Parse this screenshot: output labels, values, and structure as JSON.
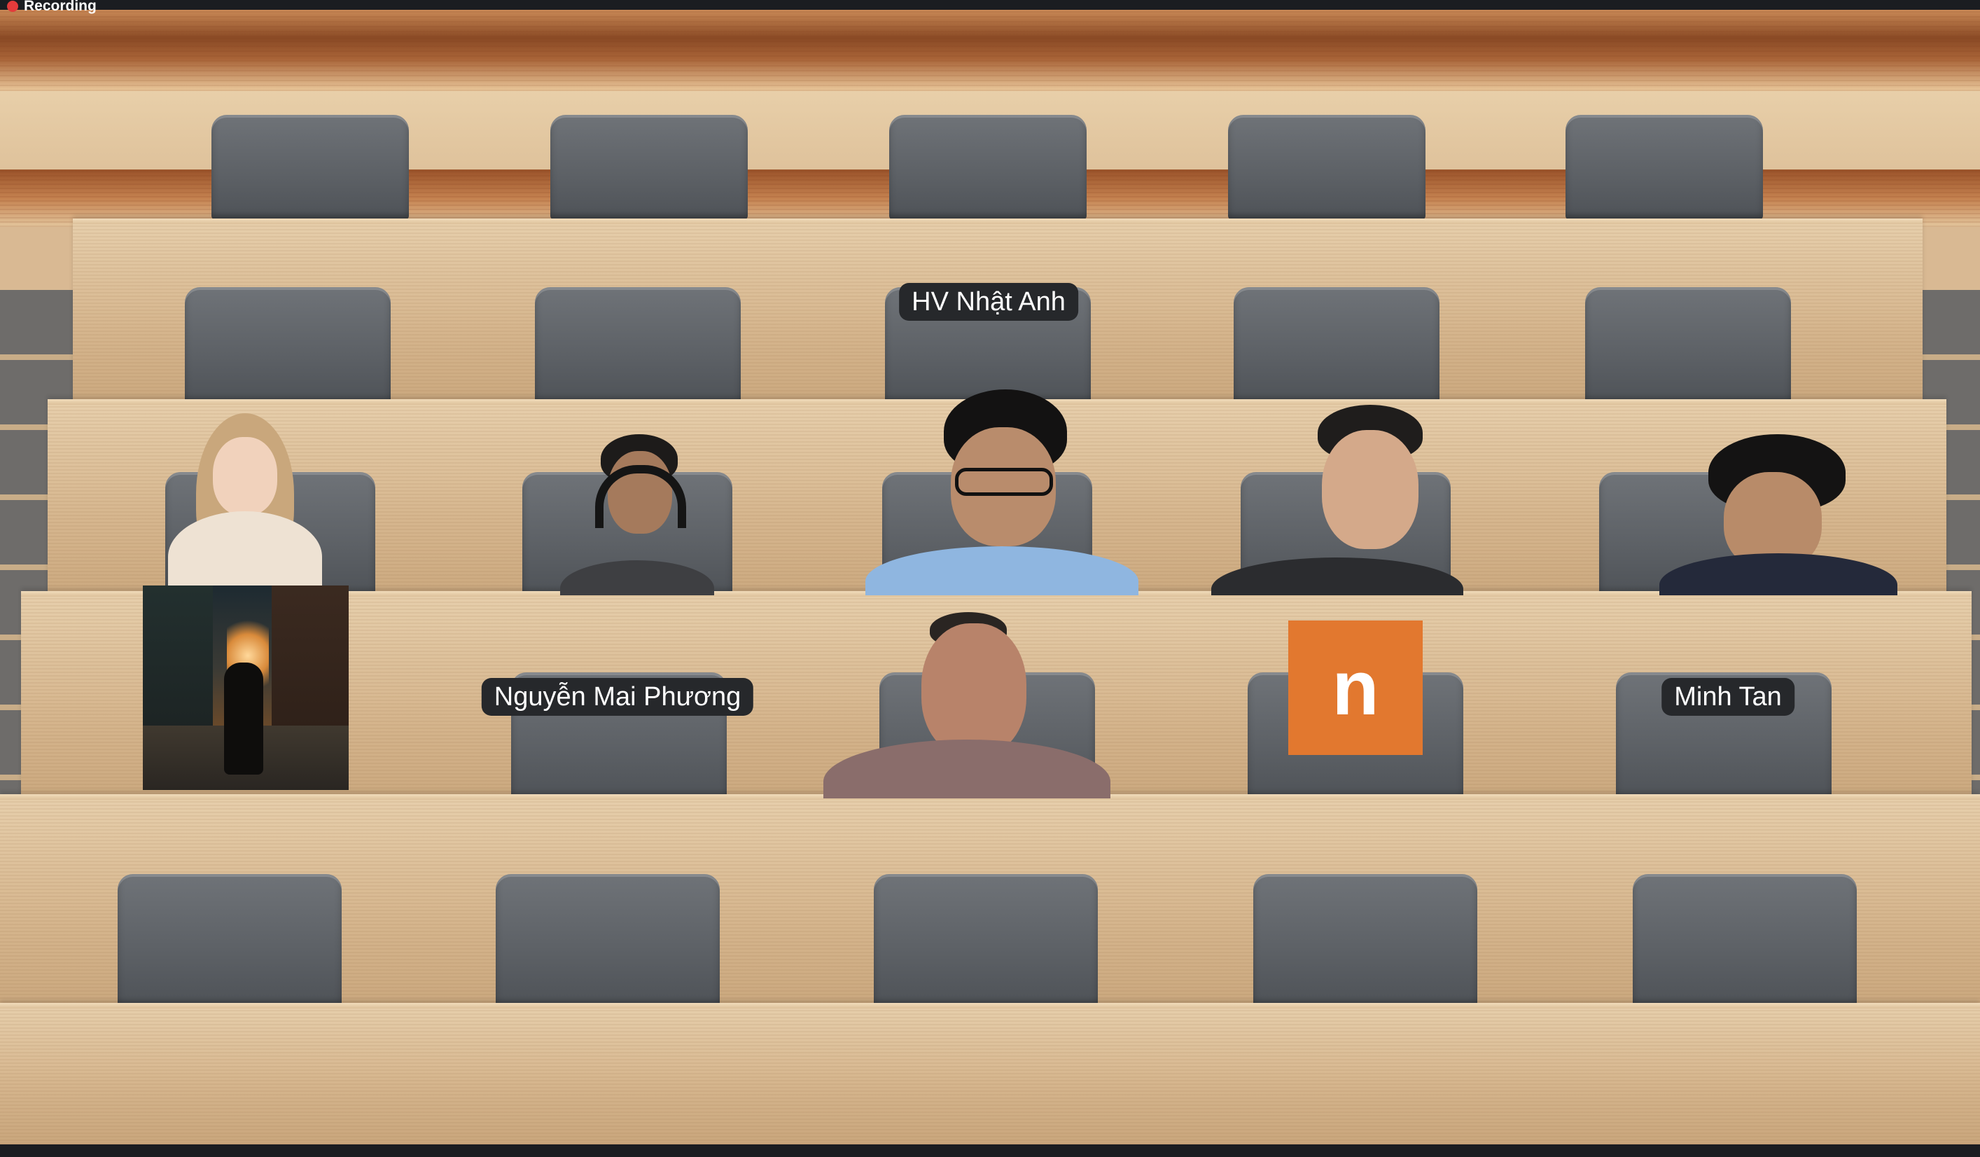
{
  "recording": {
    "label": "Recording",
    "dot_color": "#e33b3b"
  },
  "participants": [
    {
      "id": "hv-nhat-anh",
      "name": "HV Nhật Anh",
      "video": false
    },
    {
      "id": "girl-top-left",
      "name": "",
      "video": true
    },
    {
      "id": "headphones-guy",
      "name": "",
      "video": true
    },
    {
      "id": "glasses-guy",
      "name": "",
      "video": true
    },
    {
      "id": "suit-guy",
      "name": "",
      "video": true
    },
    {
      "id": "hand-guy",
      "name": "",
      "video": true
    },
    {
      "id": "street-photo",
      "name": "",
      "video": false
    },
    {
      "id": "nguyen-mai-phuong",
      "name": "Nguyễn Mai Phương",
      "video": false
    },
    {
      "id": "presenter",
      "name": "",
      "video": true
    },
    {
      "id": "n-avatar",
      "name": "",
      "avatar_letter": "n",
      "avatar_color": "#e2782f"
    },
    {
      "id": "minh-tan",
      "name": "Minh Tan",
      "video": false
    }
  ]
}
